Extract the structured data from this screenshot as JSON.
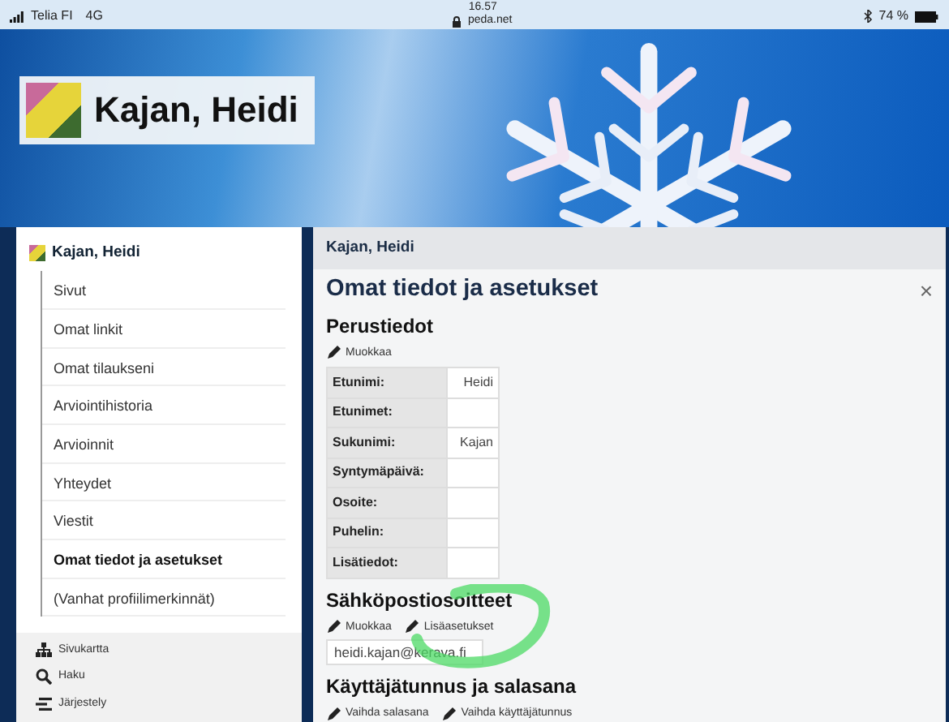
{
  "status_bar": {
    "carrier": "Telia FI",
    "network": "4G",
    "time": "16.57",
    "url": "peda.net",
    "battery": "74 %"
  },
  "banner": {
    "title": "Kajan, Heidi"
  },
  "sidebar": {
    "title": "Kajan, Heidi",
    "items": [
      {
        "label": "Sivut",
        "selected": false
      },
      {
        "label": "Omat linkit",
        "selected": false
      },
      {
        "label": "Omat tilaukseni",
        "selected": false
      },
      {
        "label": "Arviointihistoria",
        "selected": false
      },
      {
        "label": "Arvioinnit",
        "selected": false
      },
      {
        "label": "Yhteydet",
        "selected": false
      },
      {
        "label": "Viestit",
        "selected": false
      },
      {
        "label": "Omat tiedot ja asetukset",
        "selected": true
      },
      {
        "label": "(Vanhat profiilimerkinnät)",
        "selected": false
      }
    ],
    "tools": [
      {
        "kind": "sitemap",
        "label": "Sivukartta"
      },
      {
        "kind": "search",
        "label": "Haku"
      },
      {
        "kind": "arrange",
        "label": "Järjestely"
      }
    ]
  },
  "main": {
    "breadcrumb": "Kajan, Heidi",
    "title": "Omat tiedot ja asetukset",
    "close": "×",
    "basic": {
      "heading": "Perustiedot",
      "actions": [
        "Muokkaa"
      ],
      "rows": [
        {
          "label": "Etunimi:",
          "value": "Heidi"
        },
        {
          "label": "Etunimet:"
        },
        {
          "label": "Sukunimi:",
          "value": "Kajan"
        },
        {
          "label": "Syntymäpäivä:"
        },
        {
          "label": "Osoite:"
        },
        {
          "label": "Puhelin:"
        },
        {
          "label": "Lisätiedot:"
        }
      ]
    },
    "email": {
      "heading": "Sähköpostiosoitteet",
      "actions": [
        "Muokkaa",
        "Lisäasetukset"
      ],
      "addresses": [
        "heidi.kajan@kerava.fi"
      ]
    },
    "account": {
      "heading": "Käyttäjätunnus ja salasana",
      "actions": [
        "Vaihda salasana",
        "Vaihda käyttäjätunnus"
      ]
    }
  }
}
